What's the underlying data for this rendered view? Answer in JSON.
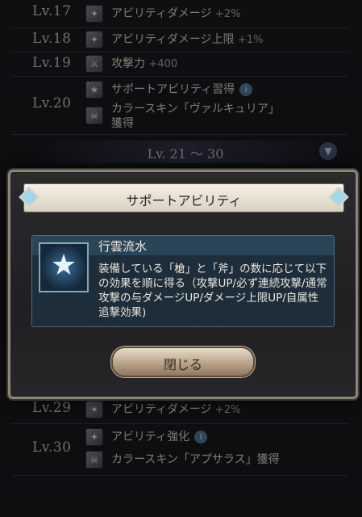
{
  "rows_top": [
    {
      "level": "Lv.17",
      "icon": "sparkle-icon",
      "text": "アビリティダメージ",
      "value": "+2%"
    },
    {
      "level": "Lv.18",
      "icon": "sparkle-icon",
      "text": "アビリティダメージ上限",
      "value": "+1%"
    },
    {
      "level": "Lv.19",
      "icon": "sword-icon",
      "text": "攻撃力",
      "value": "+400"
    }
  ],
  "row20": {
    "level": "Lv.20",
    "line1": "サポートアビリティ習得",
    "line2": "カラースキン「ヴァルキュリア」",
    "line3": "獲得"
  },
  "range_label": "Lv. 21 〜 30",
  "rows_bottom": [
    {
      "level": "Lv.29",
      "icon": "sparkle-icon",
      "text": "アビリティダメージ",
      "value": "+2%"
    }
  ],
  "row30": {
    "level": "Lv.30",
    "line1": "アビリティ強化",
    "line2": "カラースキン「アプサラス」獲得"
  },
  "modal": {
    "title": "サポートアビリティ",
    "skill_name": "行雲流水",
    "skill_desc": "装備している「槍」と「斧」の数に応じて以下の効果を順に得る（攻撃UP/必ず連続攻撃/通常攻撃の与ダメージUP/ダメージ上限UP/自属性追撃効果)",
    "close_label": "閉じる"
  },
  "colors": {
    "accent": "#9fd8ea",
    "panel": "#1d2d3a",
    "button": "#b9a38a"
  }
}
